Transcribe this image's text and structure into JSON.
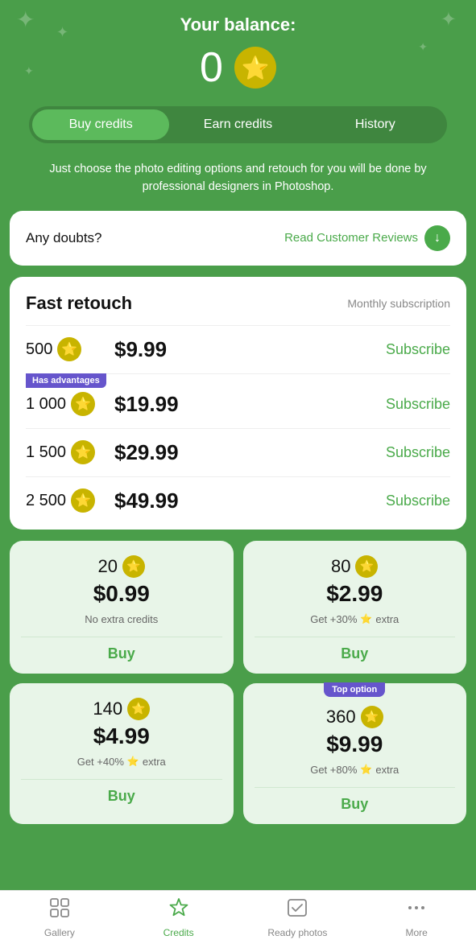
{
  "header": {
    "title": "Your balance:",
    "balance": "0"
  },
  "tabs": [
    {
      "id": "buy",
      "label": "Buy credits",
      "active": true
    },
    {
      "id": "earn",
      "label": "Earn credits",
      "active": false
    },
    {
      "id": "history",
      "label": "History",
      "active": false
    }
  ],
  "subtitle": "Just choose the photo editing options and retouch for you will be done by professional designers in Photoshop.",
  "doubts": {
    "question": "Any doubts?",
    "link_text": "Read Customer Reviews"
  },
  "fast_retouch": {
    "title": "Fast retouch",
    "column_label": "Monthly subscription",
    "rows": [
      {
        "credits": "500",
        "price": "$9.99",
        "btn": "Subscribe",
        "badge": null
      },
      {
        "credits": "1 000",
        "price": "$19.99",
        "btn": "Subscribe",
        "badge": "Has advantages"
      },
      {
        "credits": "1 500",
        "price": "$29.99",
        "btn": "Subscribe",
        "badge": null
      },
      {
        "credits": "2 500",
        "price": "$49.99",
        "btn": "Subscribe",
        "badge": null
      }
    ]
  },
  "buy_cards": [
    {
      "credits": "20",
      "price": "$0.99",
      "extra": "No extra credits",
      "extra_icon": false,
      "btn": "Buy",
      "badge": null
    },
    {
      "credits": "80",
      "price": "$2.99",
      "extra": "Get +30%",
      "extra_suffix": "extra",
      "extra_icon": true,
      "btn": "Buy",
      "badge": null
    },
    {
      "credits": "140",
      "price": "$4.99",
      "extra": "Get +40%",
      "extra_suffix": "extra",
      "extra_icon": true,
      "btn": "Buy",
      "badge": null
    },
    {
      "credits": "360",
      "price": "$9.99",
      "extra": "Get +80%",
      "extra_suffix": "extra",
      "extra_icon": true,
      "btn": "Buy",
      "badge": "Top option"
    }
  ],
  "bottom_nav": [
    {
      "id": "gallery",
      "label": "Gallery",
      "icon": "grid",
      "active": false
    },
    {
      "id": "credits",
      "label": "Credits",
      "icon": "star",
      "active": true
    },
    {
      "id": "ready",
      "label": "Ready photos",
      "icon": "check-square",
      "active": false
    },
    {
      "id": "more",
      "label": "More",
      "icon": "dots",
      "active": false
    }
  ],
  "colors": {
    "green": "#4aaa4a",
    "gold": "#c8b400",
    "purple": "#6655cc",
    "light_green_bg": "#e8f5e8"
  }
}
